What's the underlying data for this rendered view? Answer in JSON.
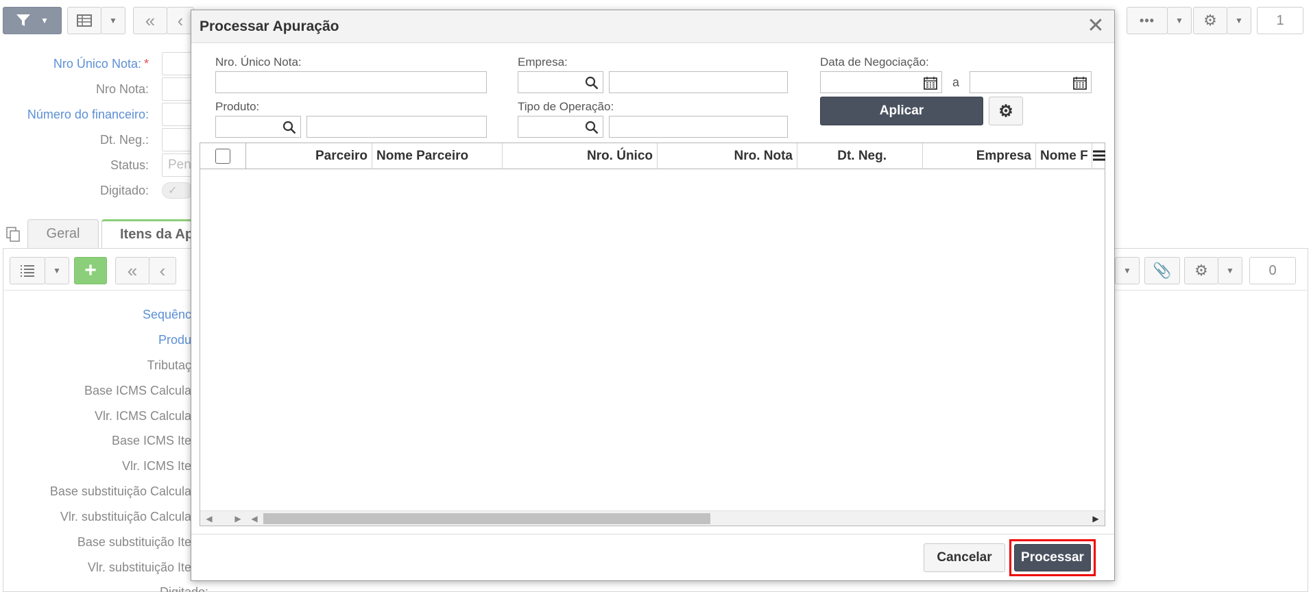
{
  "background": {
    "toolbar_counter": "1",
    "form_labels": {
      "nro_unico_nota": "Nro Único Nota:",
      "required_mark": "*",
      "nro_nota": "Nro Nota:",
      "numero_financeiro": "Número do financeiro:",
      "dt_neg": "Dt. Neg.:",
      "status": "Status:",
      "status_value": "Pen",
      "digitado": "Digitado:"
    },
    "tabs": {
      "geral": "Geral",
      "itens": "Itens da Ap"
    },
    "detail_counter": "0",
    "detail_labels": [
      "Sequênc",
      "Produ",
      "Tributaç",
      "Base ICMS Calcula",
      "Vlr. ICMS Calcula",
      "Base ICMS Ite",
      "Vlr. ICMS Ite",
      "Base substituição Calcula",
      "Vlr. substituição Calcula",
      "Base substituição Ite",
      "Vlr. substituição Ite",
      "Digitado:"
    ]
  },
  "modal": {
    "title": "Processar Apuração",
    "close_glyph": "✕",
    "filters": {
      "nro_unico_nota_label": "Nro. Único Nota:",
      "empresa_label": "Empresa:",
      "data_negociacao_label": "Data de Negociação:",
      "date_separator": "a",
      "produto_label": "Produto:",
      "tipo_operacao_label": "Tipo de Operação:",
      "apply_button": "Aplicar"
    },
    "grid": {
      "columns": [
        "Parceiro",
        "Nome Parceiro",
        "Nro. Único",
        "Nro. Nota",
        "Dt. Neg.",
        "Empresa",
        "Nome F"
      ]
    },
    "footer": {
      "cancel_button": "Cancelar",
      "process_button": "Processar"
    }
  },
  "colors": {
    "primary_button": "#4a5260",
    "highlight": "#ee0000",
    "link_label": "#5b8fd6",
    "add_button": "#8ccf7b"
  }
}
